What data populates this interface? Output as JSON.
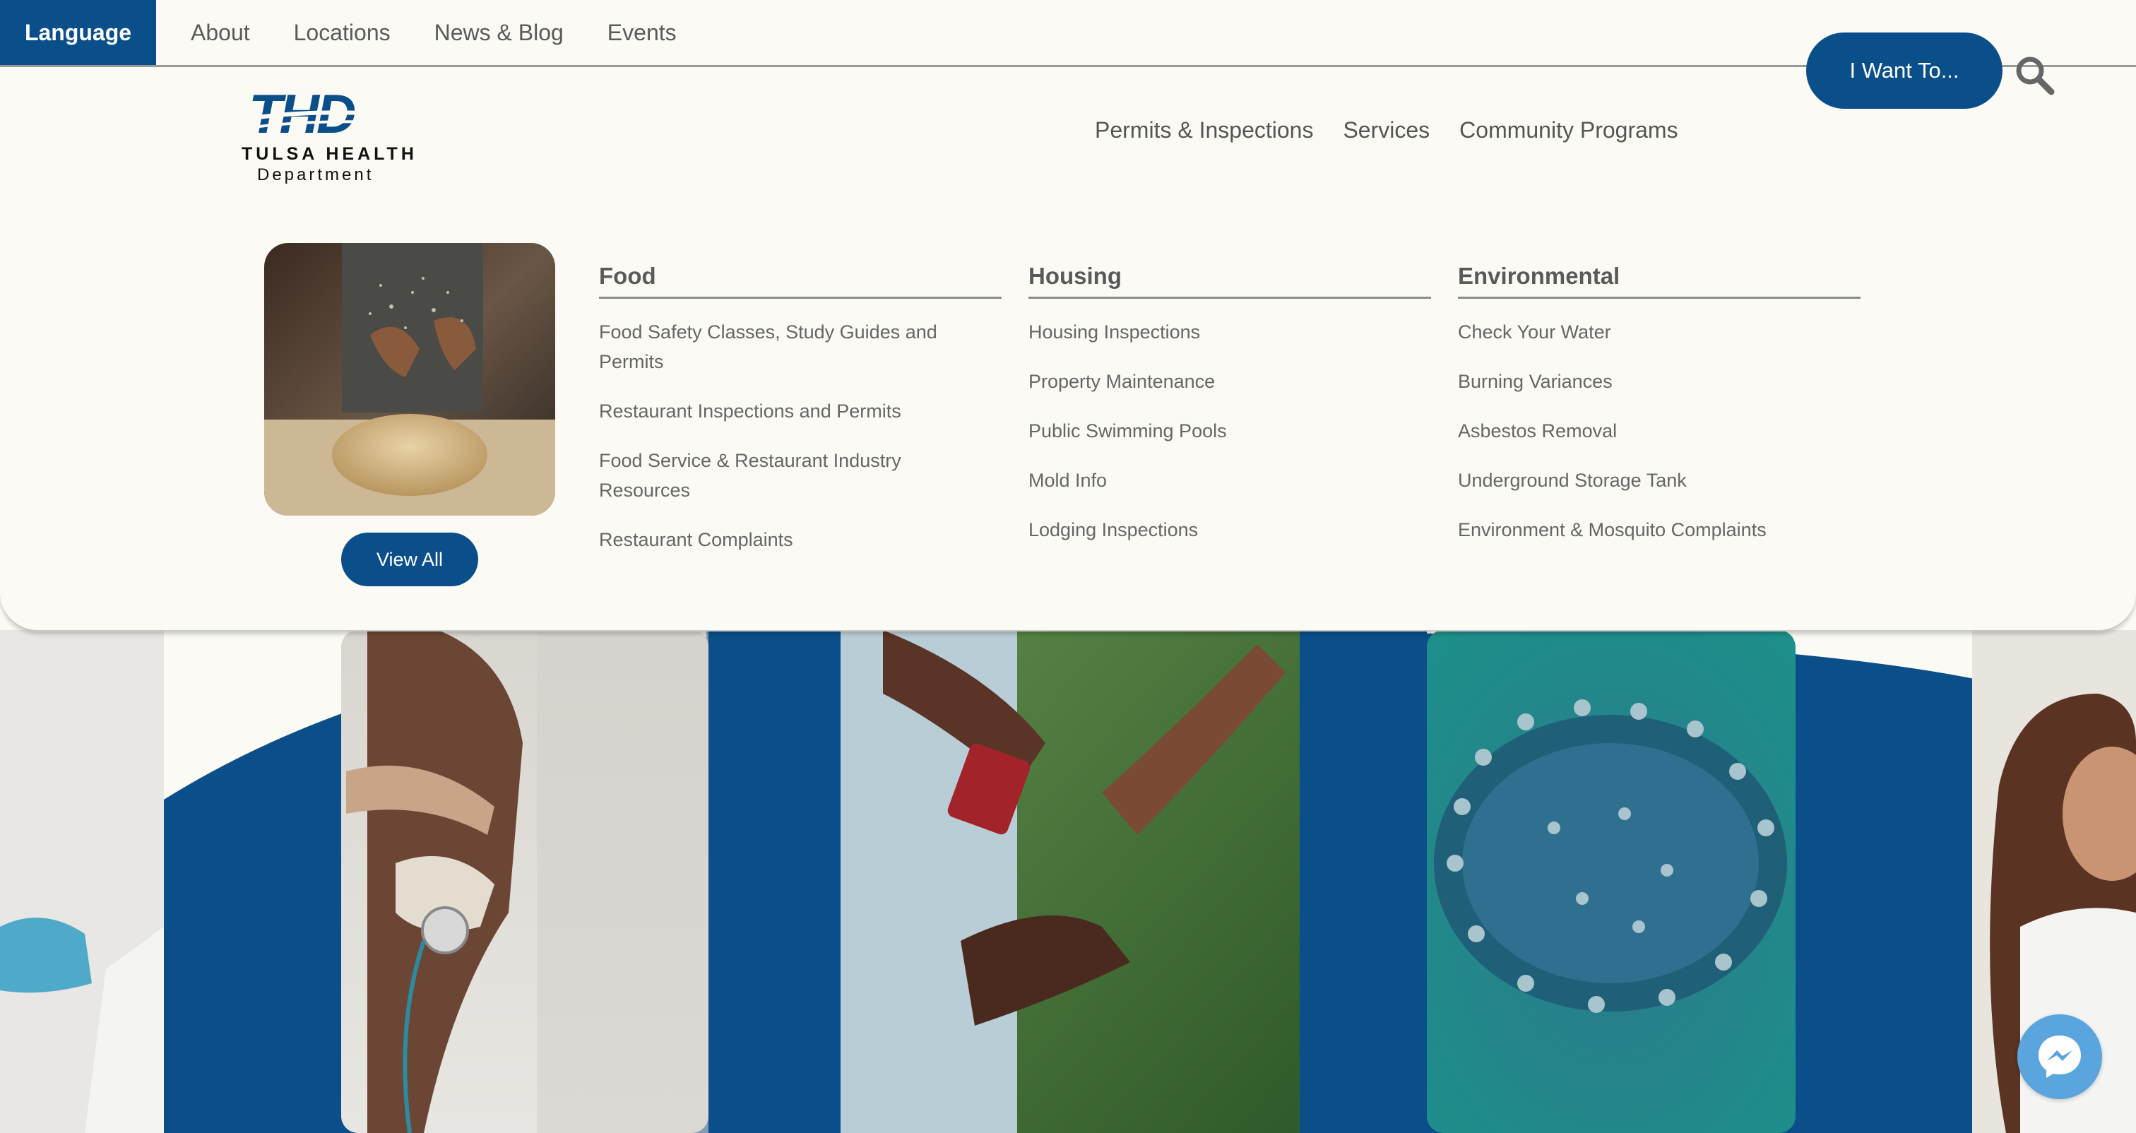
{
  "topbar": {
    "language_label": "Language",
    "links": [
      "About",
      "Locations",
      "News & Blog",
      "Events"
    ],
    "iwant_label": "I Want To..."
  },
  "logo": {
    "mark": "THD",
    "line1": "TULSA HEALTH",
    "line2": "Department"
  },
  "main_nav": [
    "Permits & Inspections",
    "Services",
    "Community Programs"
  ],
  "mega": {
    "view_all_label": "View All",
    "columns": [
      {
        "title": "Food",
        "items": [
          "Food Safety Classes, Study Guides and Permits",
          "Restaurant Inspections and Permits",
          "Food Service & Restaurant Industry Resources",
          "Restaurant Complaints"
        ]
      },
      {
        "title": "Housing",
        "items": [
          "Housing Inspections",
          "Property Maintenance",
          "Public Swimming Pools",
          "Mold Info",
          "Lodging Inspections"
        ]
      },
      {
        "title": "Environmental",
        "items": [
          "Check Your Water",
          "Burning Variances",
          "Asbestos Removal",
          "Underground Storage Tank",
          "Environment & Mosquito Complaints"
        ]
      }
    ]
  },
  "colors": {
    "brand_blue": "#0b4f8a",
    "background": "#fbfaf4",
    "messenger": "#5aa5dd"
  },
  "icons": [
    "search-icon",
    "messenger-icon"
  ]
}
